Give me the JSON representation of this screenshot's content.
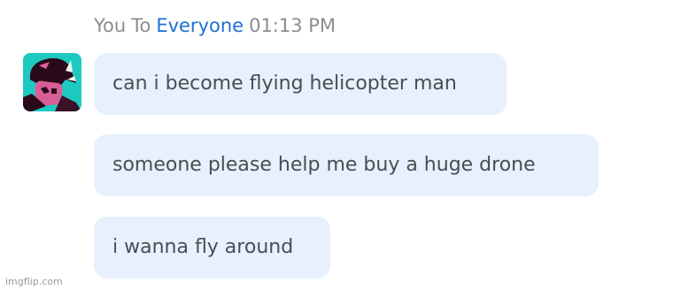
{
  "header": {
    "sender": "You",
    "to_word": "To",
    "recipient": "Everyone",
    "timestamp": "01:13 PM"
  },
  "avatar": {
    "icon": "avatar-character-icon",
    "colors": {
      "background": "#1ec9c2",
      "figure": "#2a0a1a",
      "accent": "#e0609a"
    }
  },
  "messages": [
    {
      "text": "can i become flying helicopter man"
    },
    {
      "text": "someone please help me buy a huge drone"
    },
    {
      "text": "i wanna fly around"
    }
  ],
  "watermark": {
    "text": "imgflip.com"
  },
  "colors": {
    "bubble": "#e7f0fc",
    "message_text": "#4a4d52",
    "meta_text": "#8a8d92",
    "recipient_link": "#1f6fd6"
  }
}
